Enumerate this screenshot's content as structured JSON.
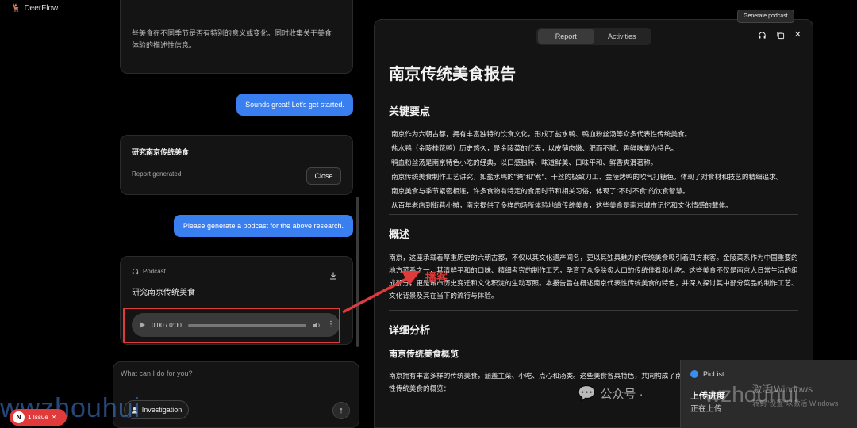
{
  "app": {
    "title": "DeerFlow",
    "logo_icon": "deer-icon"
  },
  "chat": {
    "top_card_lines": [
      "些美食在不同季节是否有特别的意义或变化。同时收集关于美食",
      "体验的描述性信息。"
    ],
    "messages": [
      {
        "role": "user",
        "text": "Sounds great! Let's get started."
      },
      {
        "role": "user",
        "text": "Please generate a podcast for the above research."
      }
    ],
    "report_card": {
      "title": "研究南京传统美食",
      "status": "Report generated",
      "close_label": "Close"
    },
    "podcast_card": {
      "label": "Podcast",
      "title": "研究南京传统美食",
      "time": "0:00 / 0:00",
      "progress": 0
    },
    "input": {
      "placeholder": "What can I do for you?",
      "investigation_label": "Investigation",
      "send_icon": "arrow-up-icon"
    }
  },
  "issue_badge": {
    "avatar": "N",
    "label": "1 Issue"
  },
  "panel": {
    "tabs": [
      {
        "label": "Report",
        "active": true
      },
      {
        "label": "Activities",
        "active": false
      }
    ],
    "tooltip": "Generate podcast",
    "report": {
      "title": "南京传统美食报告",
      "key_points_heading": "关键要点",
      "key_points": [
        "南京作为六朝古都，拥有丰富独特的饮食文化，形成了盐水鸭、鸭血粉丝汤等众多代表性传统美食。",
        "盐水鸭（金陵桂花鸭）历史悠久，是金陵菜的代表，以皮薄肉嫩、肥而不腻、香鲜味美为特色。",
        "鸭血粉丝汤是南京特色小吃的经典，以口感独特、味道鲜美、口味平和、鲜香爽滑著称。",
        "南京传统美食制作工艺讲究，如盐水鸭的\"腌\"和\"煮\"、干丝的极致刀工、金陵烤鸭的吹气打糖色，体现了对食材和技艺的精细追求。",
        "南京美食与季节紧密相连，许多食物有特定的食用时节和相关习俗，体现了\"不时不食\"的饮食智慧。",
        "从百年老店到街巷小摊，南京提供了多样的场所体验地道传统美食，这些美食是南京城市记忆和文化情感的载体。"
      ],
      "overview_heading": "概述",
      "overview_text": "南京，这座承载着厚重历史的六朝古都，不仅以其文化遗产闻名，更以其独具魅力的传统美食吸引着四方来客。金陵菜系作为中国重要的地方菜系之一，其清鲜平和的口味、精细考究的制作工艺，孕育了众多脍炙人口的传统佳肴和小吃。这些美食不仅是南京人日常生活的组成部分，更是城市历史变迁和文化积淀的生动写照。本报告旨在概述南京代表性传统美食的特色，并深入探讨其中部分菜品的制作工艺、文化背景及其在当下的流行与体验。",
      "detail_heading": "详细分析",
      "sub_heading": "南京传统美食概览",
      "sub_text": "南京拥有丰富多样的传统美食，涵盖主菜、小吃、点心和汤类。这些美食各具特色，共同构成了南京独特的饮食文化。以下列举部分代表性传统美食的概览："
    }
  },
  "annotation": {
    "text": "播客"
  },
  "notification": {
    "app": "PicList",
    "title": "上传进度",
    "status": "正在上传"
  },
  "watermarks": {
    "left": "wwzhouhui",
    "right": "wzhouhui",
    "wechat": "公众号 ·",
    "windows_1": "激活 Windows",
    "windows_2": "转到\"设置\"以激活 Windows"
  }
}
